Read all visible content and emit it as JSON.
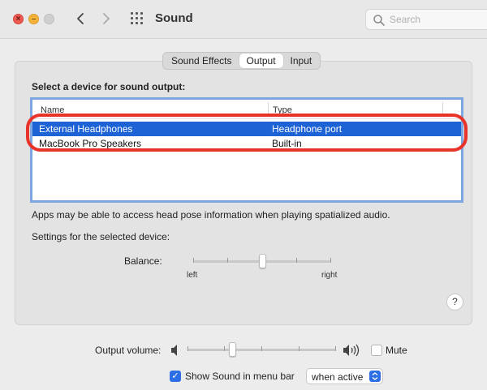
{
  "window": {
    "title": "Sound"
  },
  "search": {
    "placeholder": "Search"
  },
  "tabs": [
    {
      "label": "Sound Effects",
      "active": false
    },
    {
      "label": "Output",
      "active": true
    },
    {
      "label": "Input",
      "active": false
    }
  ],
  "output": {
    "heading": "Select a device for sound output:",
    "columns": [
      "Name",
      "Type"
    ],
    "devices": [
      {
        "name": "External Headphones",
        "type": "Headphone port",
        "selected": true
      },
      {
        "name": "MacBook Pro Speakers",
        "type": "Built-in",
        "selected": false
      }
    ],
    "note": "Apps may be able to access head pose information when playing spatialized audio.",
    "settings_label": "Settings for the selected device:",
    "balance": {
      "label": "Balance:",
      "left_label": "left",
      "right_label": "right",
      "value": 0.5
    }
  },
  "help": {
    "label": "?"
  },
  "volume": {
    "label": "Output volume:",
    "level": 0.3,
    "mute_label": "Mute",
    "muted": false
  },
  "menu_bar": {
    "label": "Show Sound in menu bar",
    "checked": true,
    "option": "when active"
  },
  "colors": {
    "selection": "#1e63d6",
    "highlight_ring": "#e8332a",
    "accent": "#2b6ee6"
  }
}
